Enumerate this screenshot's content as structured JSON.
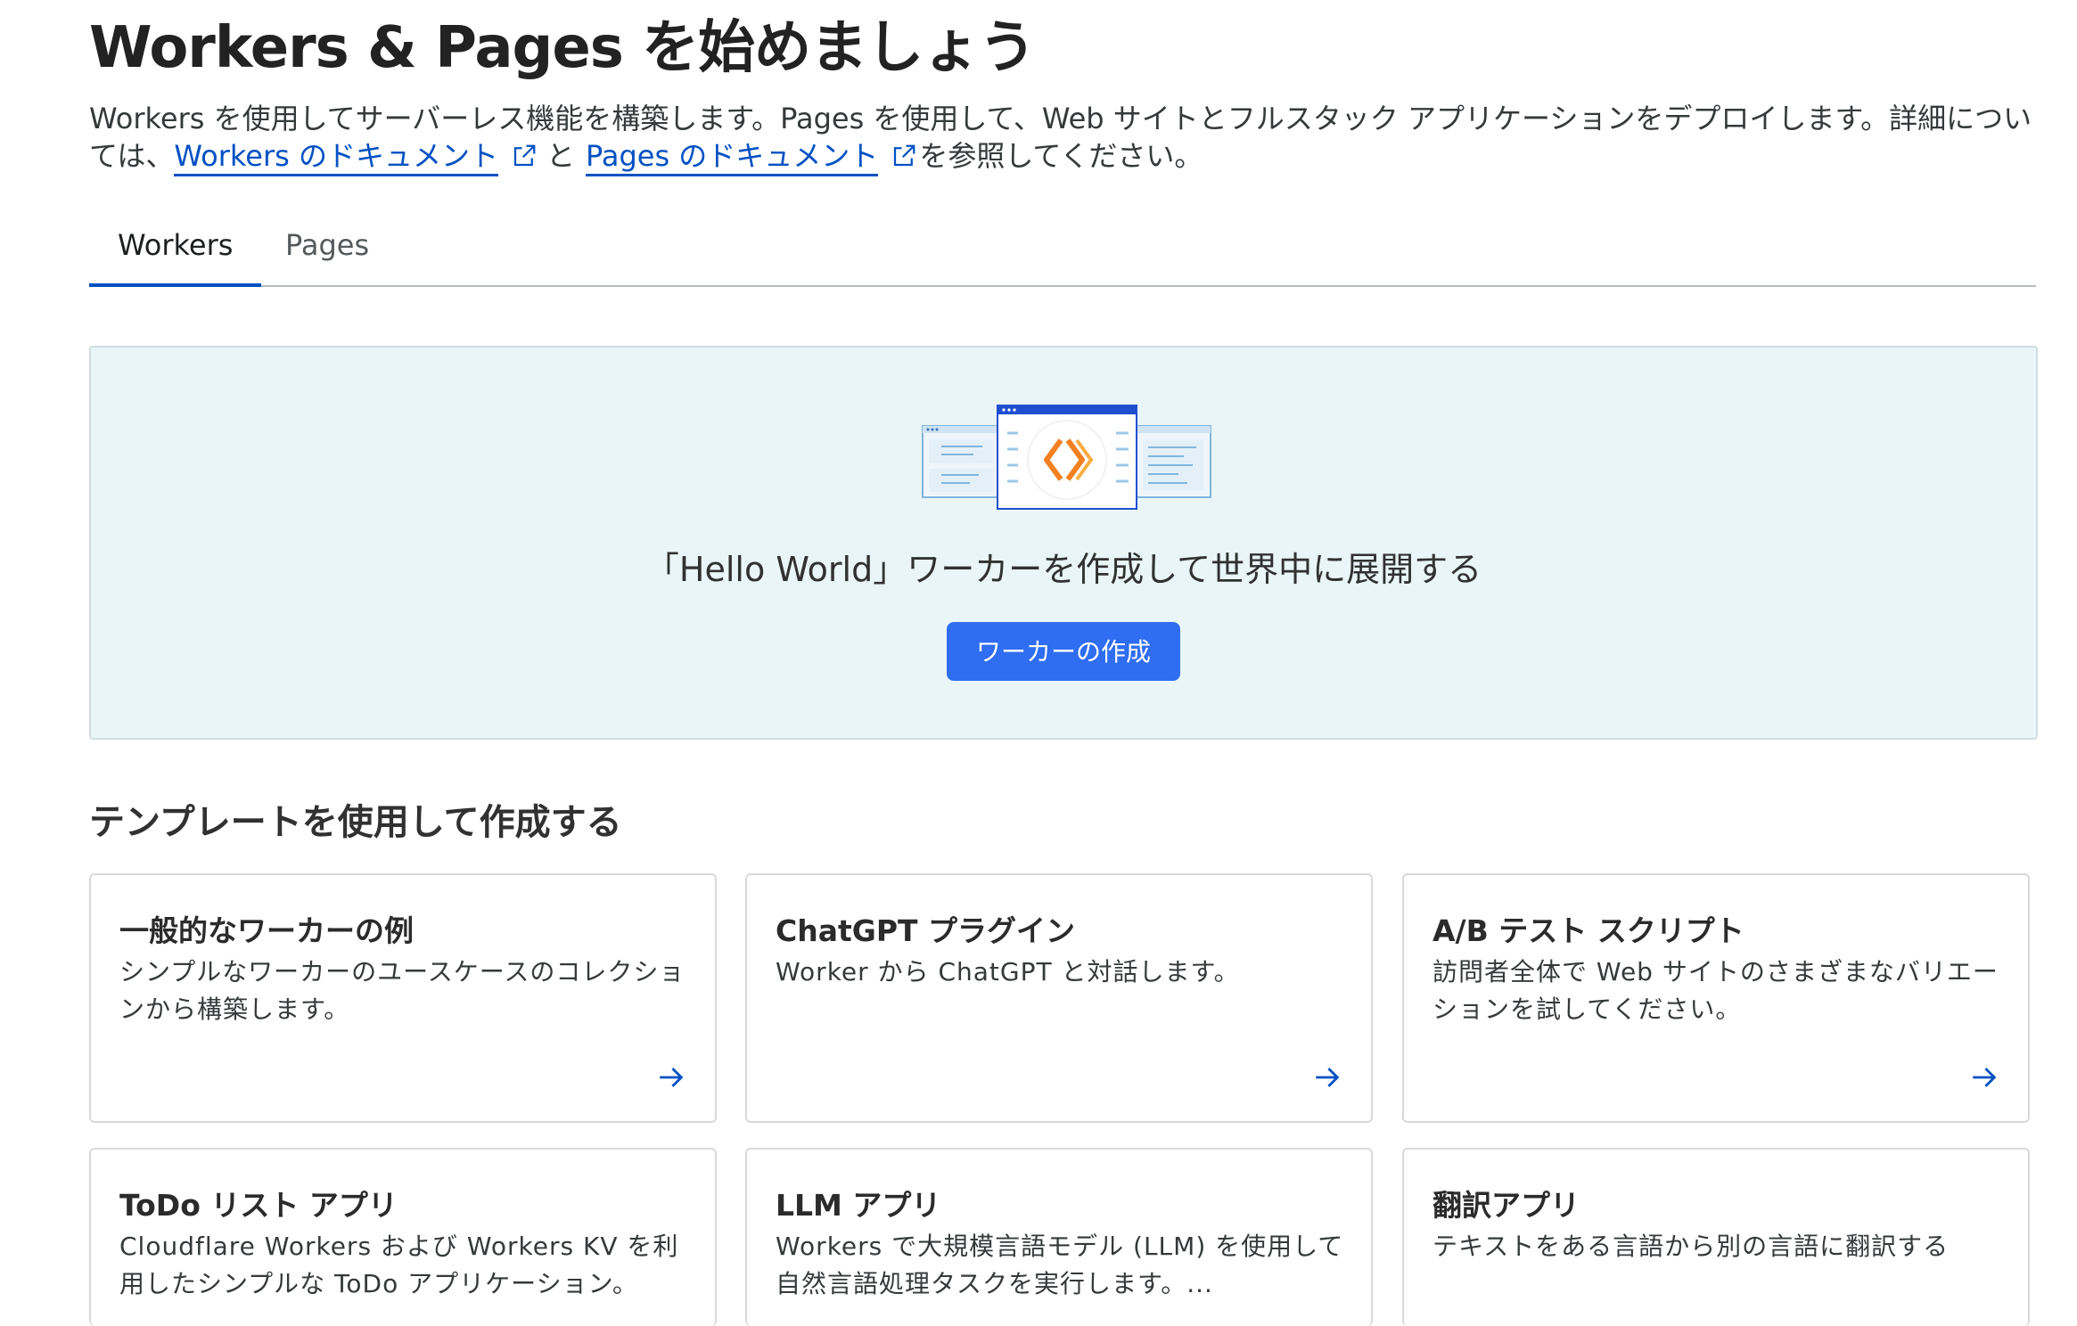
{
  "header": {
    "title": "Workers & Pages を始めましょう",
    "intro_part1": "Workers を使用してサーバーレス機能を構築します。Pages を使用して、Web サイトとフルスタック アプリケーションをデプロイします。詳細については、",
    "link_workers_docs": "Workers のドキュメント",
    "intro_and": "と",
    "link_pages_docs": "Pages のドキュメント",
    "intro_part2": "を参照してください。"
  },
  "tabs": [
    {
      "label": "Workers",
      "active": true
    },
    {
      "label": "Pages",
      "active": false
    }
  ],
  "hero": {
    "text": "「Hello World」ワーカーを作成して世界中に展開する",
    "button_label": "ワーカーの作成"
  },
  "templates": {
    "section_title": "テンプレートを使用して作成する",
    "cards": [
      {
        "title": "一般的なワーカーの例",
        "description": "シンプルなワーカーのユースケースのコレクションから構築します。"
      },
      {
        "title": "ChatGPT プラグイン",
        "description": "Worker から ChatGPT と対話します。"
      },
      {
        "title": "A/B テスト スクリプト",
        "description": "訪問者全体で Web サイトのさまざまなバリエーションを試してください。"
      },
      {
        "title": "ToDo リスト アプリ",
        "description": "Cloudflare Workers および Workers KV を利用したシンプルな ToDo アプリケーション。"
      },
      {
        "title": "LLM アプリ",
        "description": "Workers で大規模言語モデル (LLM) を使用して自然言語処理タスクを実行します。..."
      },
      {
        "title": "翻訳アプリ",
        "description": "テキストをある言語から別の言語に翻訳する"
      }
    ]
  },
  "colors": {
    "accent": "#0051c3",
    "button": "#2f6df2",
    "hero_bg": "#e9f5f7",
    "illustration_orange": "#f38020"
  }
}
